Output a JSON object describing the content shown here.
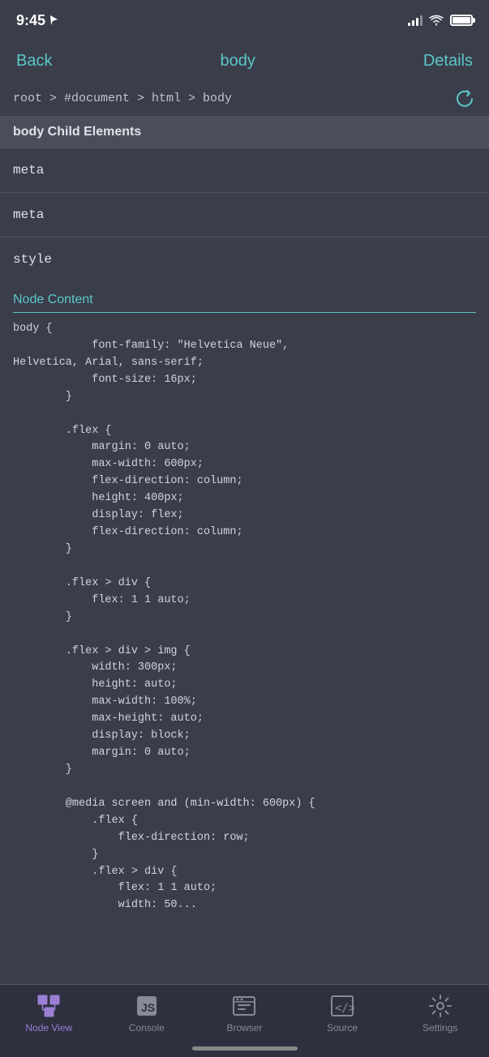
{
  "status_bar": {
    "time": "9:45",
    "location_icon": "location-arrow-icon"
  },
  "nav": {
    "back_label": "Back",
    "title": "body",
    "details_label": "Details"
  },
  "breadcrumb": {
    "path": "root > #document > html > body",
    "refresh_icon": "refresh-icon"
  },
  "section": {
    "header": "body Child Elements"
  },
  "list_items": [
    {
      "label": "meta"
    },
    {
      "label": "meta"
    },
    {
      "label": "style"
    }
  ],
  "style_node": {
    "node_content_label": "Node Content",
    "code": "body {\n            font-family: \"Helvetica Neue\",\nHelvetica, Arial, sans-serif;\n            font-size: 16px;\n        }\n\n        .flex {\n            margin: 0 auto;\n            max-width: 600px;\n            flex-direction: column;\n            height: 400px;\n            display: flex;\n            flex-direction: column;\n        }\n\n        .flex > div {\n            flex: 1 1 auto;\n        }\n\n        .flex > div > img {\n            width: 300px;\n            height: auto;\n            max-width: 100%;\n            max-height: auto;\n            display: block;\n            margin: 0 auto;\n        }\n\n        @media screen and (min-width: 600px) {\n            .flex {\n                flex-direction: row;\n            }\n            .flex > div {\n                flex: 1 1 auto;\n                width: 50..."
  },
  "tab_bar": {
    "tabs": [
      {
        "id": "node-view",
        "label": "Node View",
        "active": true
      },
      {
        "id": "console",
        "label": "Console",
        "active": false
      },
      {
        "id": "browser",
        "label": "Browser",
        "active": false
      },
      {
        "id": "source",
        "label": "Source",
        "active": false
      },
      {
        "id": "settings",
        "label": "Settings",
        "active": false
      }
    ]
  }
}
